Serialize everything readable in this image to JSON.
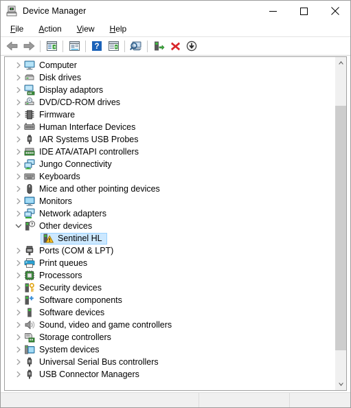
{
  "window": {
    "title": "Device Manager",
    "title_icon": "device-manager-icon",
    "controls": {
      "minimize": "minimize-icon",
      "maximize": "maximize-icon",
      "close": "close-icon"
    }
  },
  "menubar": {
    "items": [
      {
        "label": "File",
        "accel": "F"
      },
      {
        "label": "Action",
        "accel": "A"
      },
      {
        "label": "View",
        "accel": "V"
      },
      {
        "label": "Help",
        "accel": "H"
      }
    ]
  },
  "toolbar": {
    "buttons": [
      {
        "name": "back-button",
        "icon": "left-arrow-icon"
      },
      {
        "name": "forward-button",
        "icon": "right-arrow-icon"
      },
      {
        "name": "separator-1",
        "icon": "separator"
      },
      {
        "name": "show-hide-console-tree-button",
        "icon": "console-tree-icon"
      },
      {
        "name": "separator-2",
        "icon": "separator"
      },
      {
        "name": "properties-button",
        "icon": "properties-icon"
      },
      {
        "name": "separator-3",
        "icon": "separator"
      },
      {
        "name": "help-button",
        "icon": "help-question-icon"
      },
      {
        "name": "update-driver-button",
        "icon": "update-driver-icon"
      },
      {
        "name": "separator-4",
        "icon": "separator"
      },
      {
        "name": "scan-for-hardware-changes-button",
        "icon": "scan-hardware-icon"
      },
      {
        "name": "separator-5",
        "icon": "separator"
      },
      {
        "name": "enable-device-button",
        "icon": "enable-device-icon"
      },
      {
        "name": "uninstall-device-button",
        "icon": "red-x-icon"
      },
      {
        "name": "disable-device-button",
        "icon": "down-arrow-circle-icon"
      }
    ]
  },
  "tree": {
    "items": [
      {
        "label": "Computer",
        "icon": "computer-icon",
        "expanded": false,
        "child": false,
        "selected": false
      },
      {
        "label": "Disk drives",
        "icon": "disk-drive-icon",
        "expanded": false,
        "child": false,
        "selected": false
      },
      {
        "label": "Display adaptors",
        "icon": "display-adapter-icon",
        "expanded": false,
        "child": false,
        "selected": false
      },
      {
        "label": "DVD/CD-ROM drives",
        "icon": "dvd-drive-icon",
        "expanded": false,
        "child": false,
        "selected": false
      },
      {
        "label": "Firmware",
        "icon": "firmware-chip-icon",
        "expanded": false,
        "child": false,
        "selected": false
      },
      {
        "label": "Human Interface Devices",
        "icon": "hid-keyboard-icon",
        "expanded": false,
        "child": false,
        "selected": false
      },
      {
        "label": "IAR Systems USB Probes",
        "icon": "usb-plug-icon",
        "expanded": false,
        "child": false,
        "selected": false
      },
      {
        "label": "IDE ATA/ATAPI controllers",
        "icon": "ide-controller-icon",
        "expanded": false,
        "child": false,
        "selected": false
      },
      {
        "label": "Jungo Connectivity",
        "icon": "network-screens-icon",
        "expanded": false,
        "child": false,
        "selected": false
      },
      {
        "label": "Keyboards",
        "icon": "keyboard-icon",
        "expanded": false,
        "child": false,
        "selected": false
      },
      {
        "label": "Mice and other pointing devices",
        "icon": "mouse-icon",
        "expanded": false,
        "child": false,
        "selected": false
      },
      {
        "label": "Monitors",
        "icon": "monitor-icon",
        "expanded": false,
        "child": false,
        "selected": false
      },
      {
        "label": "Network adapters",
        "icon": "network-adapter-icon",
        "expanded": false,
        "child": false,
        "selected": false
      },
      {
        "label": "Other devices",
        "icon": "other-device-question-icon",
        "expanded": true,
        "child": false,
        "selected": false
      },
      {
        "label": "Sentinel HL",
        "icon": "unknown-device-warning-icon",
        "expanded": false,
        "child": true,
        "selected": true
      },
      {
        "label": "Ports (COM & LPT)",
        "icon": "port-icon",
        "expanded": false,
        "child": false,
        "selected": false
      },
      {
        "label": "Print queues",
        "icon": "printer-icon",
        "expanded": false,
        "child": false,
        "selected": false
      },
      {
        "label": "Processors",
        "icon": "processor-icon",
        "expanded": false,
        "child": false,
        "selected": false
      },
      {
        "label": "Security devices",
        "icon": "security-key-icon",
        "expanded": false,
        "child": false,
        "selected": false
      },
      {
        "label": "Software components",
        "icon": "software-component-icon",
        "expanded": false,
        "child": false,
        "selected": false
      },
      {
        "label": "Software devices",
        "icon": "software-device-icon",
        "expanded": false,
        "child": false,
        "selected": false
      },
      {
        "label": "Sound, video and game controllers",
        "icon": "speaker-icon",
        "expanded": false,
        "child": false,
        "selected": false
      },
      {
        "label": "Storage controllers",
        "icon": "storage-controller-icon",
        "expanded": false,
        "child": false,
        "selected": false
      },
      {
        "label": "System devices",
        "icon": "system-device-icon",
        "expanded": false,
        "child": false,
        "selected": false
      },
      {
        "label": "Universal Serial Bus controllers",
        "icon": "usb-plug-icon",
        "expanded": false,
        "child": false,
        "selected": false
      },
      {
        "label": "USB Connector Managers",
        "icon": "usb-plug-icon",
        "expanded": false,
        "child": false,
        "selected": false
      }
    ]
  },
  "scrollbar": {
    "up_arrow": "scroll-up-icon",
    "down_arrow": "scroll-down-icon",
    "thumb_top_pct": 12,
    "thumb_height_pct": 79
  },
  "statusbar": {
    "pane1": "",
    "pane2": "",
    "pane3": ""
  },
  "colors": {
    "selection_fill": "#cce8ff",
    "selection_border": "#99d1ff",
    "chrome": "#f0f0f0",
    "scroll_thumb": "#cdcdcd",
    "warning_yellow": "#ffc422",
    "accent_green": "#3faf3f",
    "danger_red": "#d9252a",
    "help_blue": "#1b62b8"
  }
}
